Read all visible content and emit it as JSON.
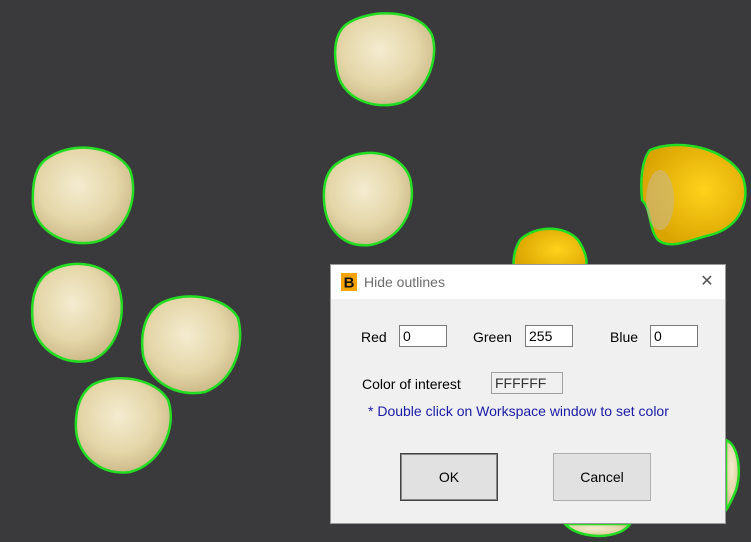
{
  "dialog": {
    "title": "Hide outlines",
    "app_icon_letter": "B",
    "close_glyph": "✕",
    "red_label": "Red",
    "red_value": "0",
    "green_label": "Green",
    "green_value": "255",
    "blue_label": "Blue",
    "blue_value": "0",
    "color_label": "Color of interest",
    "color_value": "FFFFFF",
    "hint": "* Double click on Workspace window to set color",
    "ok_label": "OK",
    "cancel_label": "Cancel"
  },
  "colors": {
    "background": "#3a393b",
    "outline": "#22dd22",
    "kernel_white": "#e8dcb4",
    "kernel_yellow": "#f0c010",
    "hint_text": "#1a1aa6"
  }
}
